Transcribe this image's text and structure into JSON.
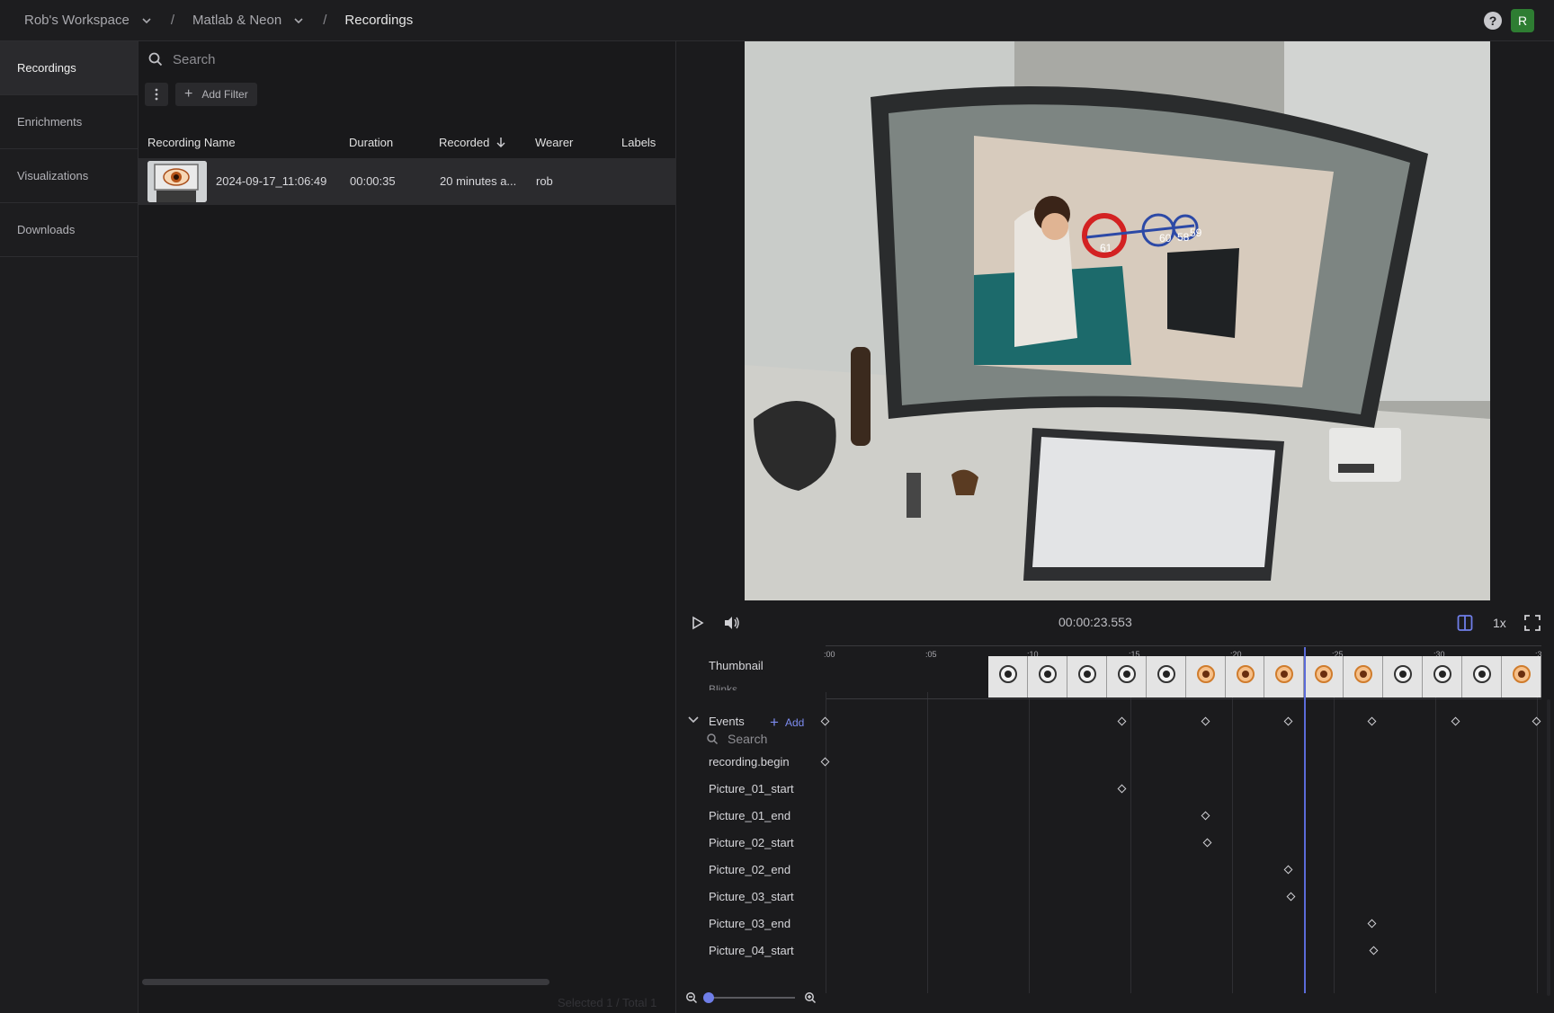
{
  "topbar": {
    "workspace": "Rob's Workspace",
    "project": "Matlab & Neon",
    "section": "Recordings",
    "help": "?",
    "avatar": "R",
    "avatar_color": "#2e7d32"
  },
  "sidebar": {
    "items": [
      {
        "label": "Recordings",
        "active": true
      },
      {
        "label": "Enrichments",
        "active": false
      },
      {
        "label": "Visualizations",
        "active": false
      },
      {
        "label": "Downloads",
        "active": false
      }
    ]
  },
  "list": {
    "search_placeholder": "Search",
    "add_filter_label": "Add Filter",
    "columns": [
      "Recording Name",
      "Duration",
      "Recorded",
      "Wearer",
      "Labels"
    ],
    "rows": [
      {
        "name": "2024-09-17_11:06:49",
        "duration": "00:00:35",
        "recorded": "20 minutes a...",
        "wearer": "rob",
        "labels": ""
      }
    ],
    "footer_faint": "Selected 1 / Total 1"
  },
  "player": {
    "timecode": "00:00:23.553",
    "speed": "1x",
    "gaze_numbers": [
      "61",
      "60",
      "58",
      "59"
    ]
  },
  "timeline": {
    "ruler": [
      ":00",
      ":05",
      ":10",
      ":15",
      ":20",
      ":25",
      ":30",
      ":3"
    ],
    "thumbnail_label": "Thumbnail",
    "hidden_label": "Blinks",
    "events_label": "Events",
    "add_label": "Add",
    "events_search_placeholder": "Search",
    "events": [
      {
        "name": "recording.begin",
        "t": 0.0
      },
      {
        "name": "Picture_01_start",
        "t": 14.6
      },
      {
        "name": "Picture_01_end",
        "t": 18.7
      },
      {
        "name": "Picture_02_start",
        "t": 18.8
      },
      {
        "name": "Picture_02_end",
        "t": 22.8
      },
      {
        "name": "Picture_03_start",
        "t": 22.9
      },
      {
        "name": "Picture_03_end",
        "t": 26.9
      },
      {
        "name": "Picture_04_start",
        "t": 27.0
      }
    ],
    "summary_marks_t": [
      0.0,
      14.6,
      18.7,
      22.8,
      26.9,
      31.0,
      35.0
    ],
    "playhead_t": 23.553,
    "accent": "#5b6bd9"
  }
}
